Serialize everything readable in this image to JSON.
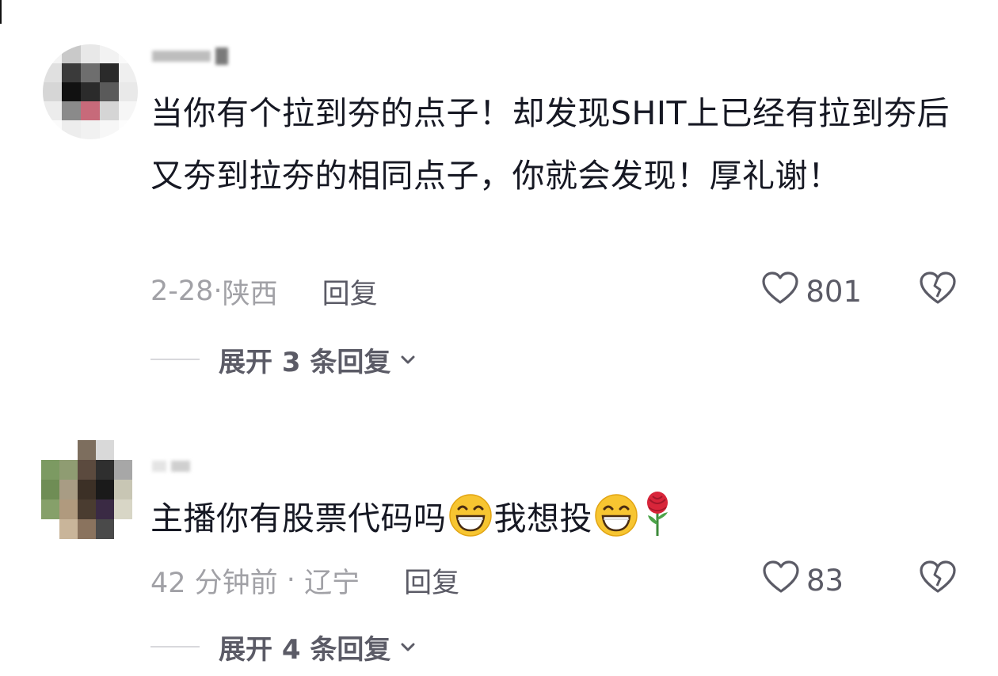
{
  "comments": [
    {
      "text": "当你有个拉到夯的点子！却发现SHIT上已经有拉到夯后又夯到拉夯的相同点子，你就会发现！厚礼谢！",
      "date": "2-28",
      "separator": "·",
      "location": "陕西",
      "reply_label": "回复",
      "likes": "801",
      "expand_label": "展开 3 条回复",
      "icons": {
        "like": "heart-outline-icon",
        "dislike": "broken-heart-icon",
        "expand": "chevron-down-icon"
      }
    },
    {
      "text_a": "主播你有股票代码吗",
      "text_b": "我想投",
      "date": "42 分钟前",
      "separator": " · ",
      "location": "辽宁",
      "reply_label": "回复",
      "likes": "83",
      "expand_label": "展开 4 条回复",
      "icons": {
        "emoji": "grinning-face-emoji",
        "flower": "rose-emoji",
        "like": "heart-outline-icon",
        "dislike": "broken-heart-icon",
        "expand": "chevron-down-icon"
      }
    }
  ],
  "colors": {
    "text": "#161823",
    "meta": "#a1a1a6",
    "action": "#5b5b66",
    "divider": "#d8d8dc"
  }
}
